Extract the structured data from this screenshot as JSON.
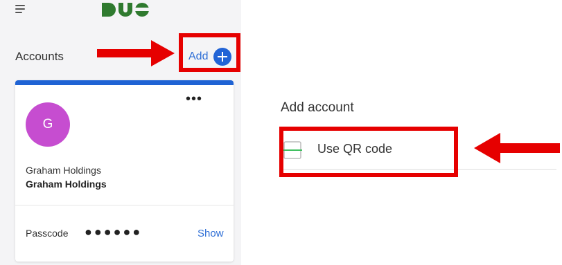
{
  "app": {
    "logo_text": "DUO",
    "brand_color": "#2f6f2f",
    "accent_color": "#2264d6"
  },
  "header": {
    "accounts_title": "Accounts",
    "add_label": "Add"
  },
  "account_card": {
    "avatar_letter": "G",
    "avatar_color": "#c64dd0",
    "account_name": "Graham Holdings",
    "account_org": "Graham Holdings",
    "more_menu": "•••",
    "passcode_label": "Passcode",
    "passcode_mask": "●●●●●●",
    "show_label": "Show"
  },
  "add_account_panel": {
    "title": "Add account",
    "option_label": "Use QR code"
  },
  "annotations": {
    "highlight_color": "#e60000"
  }
}
